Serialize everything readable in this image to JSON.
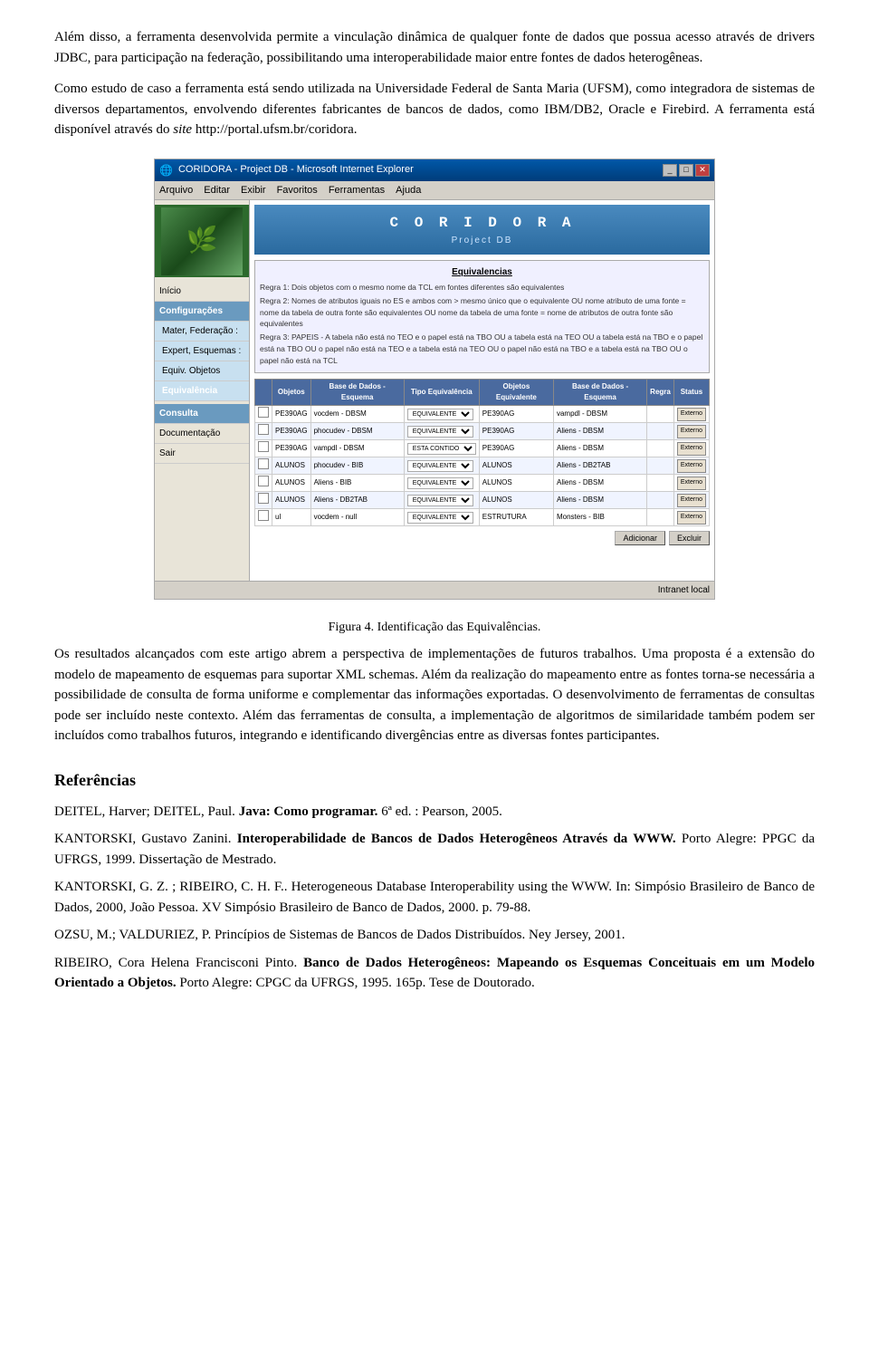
{
  "paragraphs": {
    "p1": "Além disso, a ferramenta desenvolvida permite a vinculação dinâmica de qualquer fonte de dados que possua acesso através de drivers JDBC, para participação na federação, possibilitando uma interoperabilidade maior entre fontes de dados heterogêneas.",
    "p2_pre": "Como estudo de caso a ferramenta está sendo utilizada na Universidade Federal de Santa Maria (UFSM), como integradora de sistemas de diversos departamentos, envolvendo diferentes fabricantes de bancos de dados, como IBM/DB2, Oracle e Firebird. A ferramenta está disponível através do ",
    "p2_site_label": "site",
    "p2_site": "http://portal.ufsm.br/coridora",
    "p2_post": ".",
    "figure": {
      "title_bar": "CORIDORA - Project DB - Microsoft Internet Explorer",
      "menu_items": [
        "Arquivo",
        "Editar",
        "Exibir",
        "Favoritos",
        "Ferramentas",
        "Ajuda"
      ],
      "sidebar": {
        "logo_alt": "CORIDORA logo",
        "items": [
          {
            "label": "Início",
            "active": false,
            "class": "normal"
          },
          {
            "label": "Configurações",
            "active": true,
            "class": "section-header"
          },
          {
            "label": "Mater, Federação :",
            "active": false,
            "class": "sub"
          },
          {
            "label": "Expert, Esquemas :",
            "active": false,
            "class": "sub"
          },
          {
            "label": "Equiv. Objetos",
            "active": false,
            "class": "sub"
          },
          {
            "label": "Equivalência",
            "active": false,
            "class": "sub"
          },
          {
            "label": "Consulta",
            "active": false,
            "class": "section-header2"
          },
          {
            "label": "Documentação",
            "active": false,
            "class": "normal"
          },
          {
            "label": "Sair",
            "active": false,
            "class": "normal"
          }
        ]
      },
      "main": {
        "title": "C O R I D O R A",
        "subtitle": "Project DB",
        "eq_section": {
          "title": "Equivalencias",
          "rules": [
            "Regra 1: Dois objetos com o mesmo nome da TCL em fontes diferentes são equivalentes",
            "Regra 2: Nomes de atributos iguais no ES e ambos com > mesmo único que o equivalente OU nome atributo de uma fonte = nome da tabela de outra fonte são equivalentes OU nome da tabela de uma fonte = nome de atributos de outra fonte são equivalentes",
            "Regra 3: PAPEIS - A tabela não está no TEO e o papel está na TBO OU a tabela está na TEO OU a tabela está na TBO e o papel está na TBO OU o papel não está na TEO e a tabela está na TEO OU o papel não está na TBO e a tabela está na TBO OU o papel não está na TCL"
          ]
        },
        "table": {
          "headers": [
            "",
            "Objetos",
            "Base de Dados - Esquema",
            "Tipo Equivalência",
            "Objetos Equivalente",
            "Base de Dados - Esquema",
            "Regra",
            "Status"
          ],
          "rows": [
            [
              "",
              "PE390AG",
              "vocdem - DBSM",
              "EQUIVALENTE",
              "PE390AG",
              "vampdl - DBSM",
              "",
              "Externo"
            ],
            [
              "",
              "PE390AG",
              "phocudev - DBSM",
              "EQUIVALENTE",
              "PE390AG",
              "Aliens - DBSM",
              "",
              "Externo"
            ],
            [
              "",
              "PE390AG",
              "vampdl - DBSM",
              "ESTA CONTIDO",
              "PE390AG",
              "Aliens - DBSM",
              "",
              "Externo"
            ],
            [
              "",
              "ALUNOS",
              "phocudev - BIB",
              "EQUIVALENTE",
              "ALUNOS",
              "Aliens - DB2TAB",
              "",
              "Externo"
            ],
            [
              "",
              "ALUNOS",
              "Aliens - BIB",
              "EQUIVALENTE",
              "ALUNOS",
              "Aliens - DBSM",
              "",
              "Externo"
            ],
            [
              "",
              "ALUNOS",
              "Aliens - DB2TAB",
              "EQUIVALENTE",
              "ALUNOS",
              "Aliens - DBSM",
              "",
              "Externo"
            ],
            [
              "",
              "ul",
              "vocdem - null",
              "EQUIVALENTE",
              "ESTRUTURA",
              "Monsters - BIB",
              "",
              "Externo"
            ]
          ]
        },
        "buttons": [
          "Adicionar",
          "Excluir"
        ]
      },
      "statusbar": "Intranet local"
    },
    "figure_caption": "Figura 4. Identificação das Equivalências.",
    "p3": "Os resultados alcançados com este artigo abrem a perspectiva de implementações  de  futuros trabalhos. Uma proposta é a extensão do modelo de mapeamento de esquemas para suportar XML schemas. Além da realização do mapeamento entre as fontes torna-se necessária a possibilidade de consulta de forma uniforme e complementar das informações exportadas. O desenvolvimento de ferramentas de consultas pode ser incluído neste contexto. Além das ferramentas de consulta, a implementação de algoritmos de similaridade também podem ser incluídos como trabalhos futuros, integrando e identificando divergências entre as diversas fontes participantes.",
    "references": {
      "title": "Referências",
      "items": [
        {
          "id": "ref1",
          "text_pre": "DEITEL, Harver; DEITEL, Paul. ",
          "text_bold": "Java: Como programar.",
          "text_post": " 6ª ed. : Pearson, 2005."
        },
        {
          "id": "ref2",
          "text_pre": "KANTORSKI, Gustavo Zanini. ",
          "text_bold": "Interoperabilidade de Bancos de Dados  Heterogêneos Através da WWW.",
          "text_post": " Porto Alegre: PPGC da  UFRGS, 1999. Dissertação de Mestrado."
        },
        {
          "id": "ref3",
          "text_pre": "KANTORSKI, G. Z. ; RIBEIRO, C. H. F.. Heterogeneous Database Interoperability using the WWW. In: Simpósio Brasileiro de Banco de Dados, 2000, João Pessoa. XV Simpósio Brasileiro de Banco de Dados, 2000. p. 79-88.",
          "text_bold": "",
          "text_post": ""
        },
        {
          "id": "ref4",
          "text_pre": "OZSU, M.; VALDURIEZ, P. Princípios de Sistemas de Bancos de Dados  Distribuídos.  Ney Jersey, 2001.",
          "text_bold": "",
          "text_post": ""
        },
        {
          "id": "ref5",
          "text_pre": "RIBEIRO, Cora Helena Francisconi Pinto. ",
          "text_bold": "Banco de Dados Heterogêneos: Mapeando os Esquemas Conceituais em um Modelo Orientado a Objetos.",
          "text_post": " Porto Alegre: CPGC da  UFRGS, 1995. 165p. Tese de Doutorado."
        }
      ]
    }
  }
}
